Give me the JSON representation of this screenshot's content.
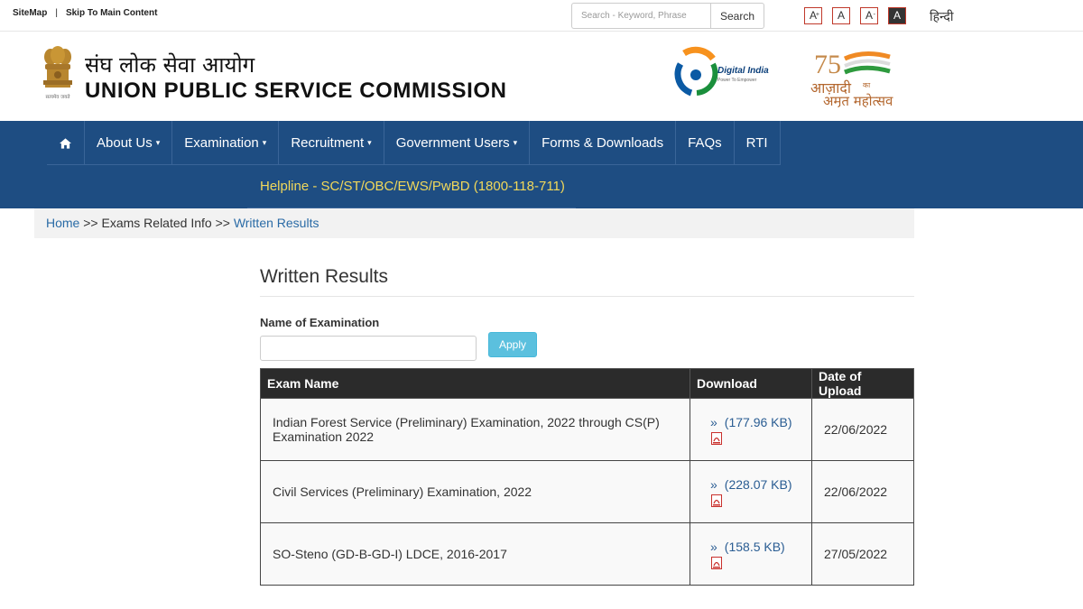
{
  "topbar": {
    "sitemap": "SiteMap",
    "separator": "|",
    "skip": "Skip To Main Content",
    "search_placeholder": "Search - Keyword, Phrase",
    "search_button": "Search",
    "font_increase": "A",
    "font_increase_sup": "+",
    "font_normal": "A",
    "font_decrease": "A",
    "font_decrease_sup": "-",
    "font_contrast": "A",
    "hindi": "हिन्दी"
  },
  "header": {
    "org_hindi": "संघ लोक सेवा आयोग",
    "org_english": "UNION PUBLIC SERVICE COMMISSION",
    "emblem_caption": "सत्यमेव जयते",
    "digital_india": "Digital India",
    "digital_india_tag": "Power To Empower",
    "akam_line1": "आज़ादी",
    "akam_ka": "का",
    "akam_line2": "अमृत महोत्सव",
    "akam_number": "75"
  },
  "nav": {
    "home_icon": "home-icon",
    "items": [
      {
        "label": "About Us",
        "caret": "▾"
      },
      {
        "label": "Examination",
        "caret": "▾"
      },
      {
        "label": "Recruitment",
        "caret": "▾"
      },
      {
        "label": "Government Users",
        "caret": "▾"
      },
      {
        "label": "Forms & Downloads",
        "caret": ""
      },
      {
        "label": "FAQs",
        "caret": ""
      },
      {
        "label": "RTI",
        "caret": ""
      }
    ],
    "helpline": "Helpline - SC/ST/OBC/EWS/PwBD (1800-118-711)"
  },
  "breadcrumb": {
    "home": "Home",
    "sep1": ">>",
    "middle": "Exams Related Info",
    "sep2": ">>",
    "current": "Written Results"
  },
  "main": {
    "title": "Written Results",
    "filter_label": "Name of Examination",
    "filter_value": "",
    "apply": "Apply"
  },
  "table": {
    "headers": [
      "Exam Name",
      "Download",
      "Date of Upload"
    ],
    "rows": [
      {
        "name": "Indian Forest Service (Preliminary) Examination, 2022 through CS(P) Examination 2022",
        "size": "(177.96 KB)",
        "date": "22/06/2022"
      },
      {
        "name": "Civil Services (Preliminary) Examination, 2022",
        "size": "(228.07 KB)",
        "date": "22/06/2022"
      },
      {
        "name": "SO-Steno (GD-B-GD-I) LDCE, 2016-2017",
        "size": "(158.5 KB)",
        "date": "27/05/2022"
      }
    ],
    "link_marker": "»"
  },
  "colors": {
    "nav_bg": "#1e4d82",
    "helpline": "#f1d85a",
    "link": "#2a6ba6",
    "apply": "#5bc0de",
    "table_header": "#2b2b2b"
  }
}
